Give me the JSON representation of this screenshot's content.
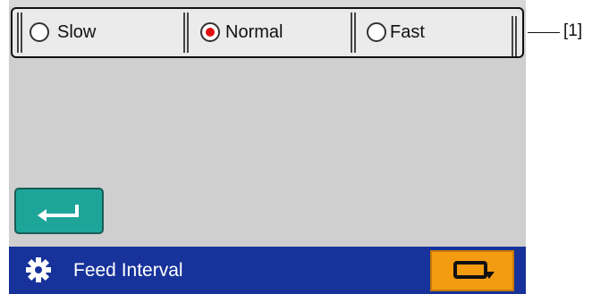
{
  "speed_options": [
    {
      "label": "Slow",
      "selected": false
    },
    {
      "label": "Normal",
      "selected": true
    },
    {
      "label": "Fast",
      "selected": false
    }
  ],
  "footer": {
    "title": "Feed Interval",
    "icon": "gear-icon"
  },
  "buttons": {
    "enter_icon": "enter-arrow-icon",
    "feed_icon": "paper-feed-icon"
  },
  "callout": {
    "label": "[1]"
  },
  "colors": {
    "screen_bg": "#cfcfcf",
    "footer_bg": "#17329a",
    "enter_button": "#1ea59a",
    "feed_button": "#f39c12",
    "selected_radio": "#e01010"
  }
}
